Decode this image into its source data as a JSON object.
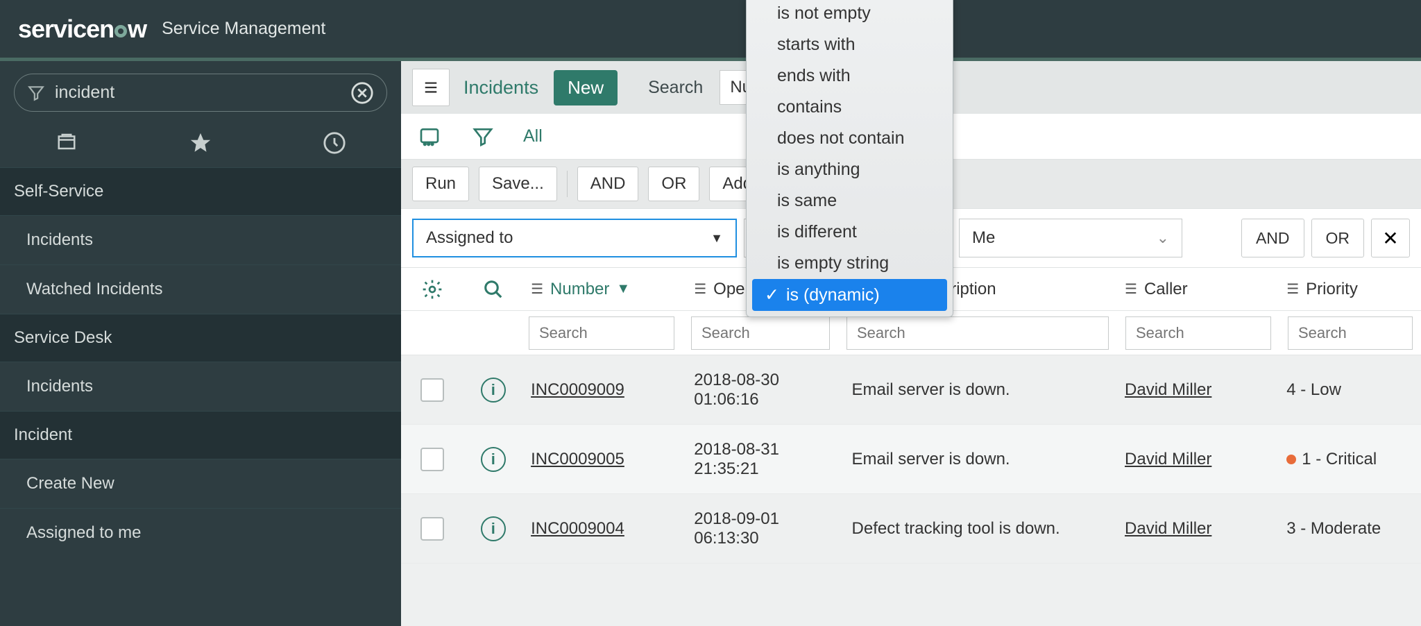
{
  "header": {
    "logo_prefix": "servicen",
    "logo_suffix": "w",
    "subtitle": "Service Management"
  },
  "sidebar": {
    "filter_value": "incident",
    "groups": [
      {
        "label": "Self-Service",
        "items": [
          "Incidents",
          "Watched Incidents"
        ]
      },
      {
        "label": "Service Desk",
        "items": [
          "Incidents"
        ]
      },
      {
        "label": "Incident",
        "items": [
          "Create New",
          "Assigned to me"
        ]
      }
    ]
  },
  "toolbar": {
    "title": "Incidents",
    "new": "New",
    "search_label": "Search",
    "search_field": "Num"
  },
  "breadcrumb": {
    "all": "All"
  },
  "cond_buttons": {
    "run": "Run",
    "save": "Save...",
    "and": "AND",
    "or": "OR",
    "addsort": "Add "
  },
  "expr": {
    "field": "Assigned to",
    "value": "Me",
    "right": {
      "and": "AND",
      "or": "OR",
      "remove": "✕"
    }
  },
  "columns": {
    "number": "Number",
    "opened": "Opened",
    "short_desc": "Short description",
    "caller": "Caller",
    "priority": "Priority",
    "search_ph": "Search"
  },
  "rows": [
    {
      "num": "INC0009009",
      "opened": "2018-08-30 01:06:16",
      "desc": "Email server is down.",
      "caller": "David Miller",
      "prio": "4 - Low",
      "critical": false
    },
    {
      "num": "INC0009005",
      "opened": "2018-08-31 21:35:21",
      "desc": "Email server is down.",
      "caller": "David Miller",
      "prio": "1 - Critical",
      "critical": true
    },
    {
      "num": "INC0009004",
      "opened": "2018-09-01 06:13:30",
      "desc": "Defect tracking tool is down.",
      "caller": "David Miller",
      "prio": "3 - Moderate",
      "critical": false
    }
  ],
  "dropdown": {
    "options": [
      "is not empty",
      "starts with",
      "ends with",
      "contains",
      "does not contain",
      "is anything",
      "is same",
      "is different",
      "is empty string"
    ],
    "selected": "is (dynamic)"
  }
}
